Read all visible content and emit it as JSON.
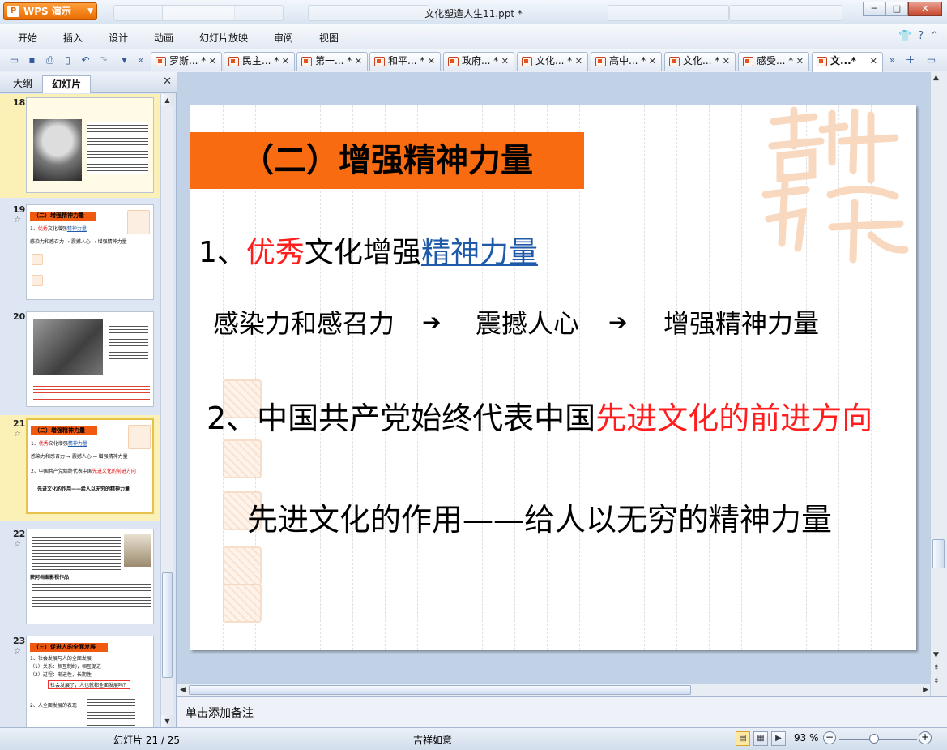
{
  "app": {
    "menu_button": "WPS 演示",
    "window_title": "文化塑造人生11.ppt *"
  },
  "menu": [
    "开始",
    "插入",
    "设计",
    "动画",
    "幻灯片放映",
    "审阅",
    "视图"
  ],
  "doc_tabs": [
    "罗斯... *",
    "民主... *",
    "第一... *",
    "和平... *",
    "政府... *",
    "文化... *",
    "高中... *",
    "文化... *",
    "感受... *",
    "文...*"
  ],
  "left_panel": {
    "tabs": [
      "大纲",
      "幻灯片"
    ],
    "active_tab": "幻灯片",
    "slides": [
      {
        "num": "18"
      },
      {
        "num": "19",
        "star": "☆"
      },
      {
        "num": "20"
      },
      {
        "num": "21",
        "star": "☆"
      },
      {
        "num": "22",
        "star": "☆"
      },
      {
        "num": "23",
        "star": "☆"
      }
    ],
    "thumb19": {
      "title": "（二）增强精神力量",
      "l1_a": "1、",
      "l1_red": "优秀",
      "l1_b": "文化增强",
      "l1_link": "精神力量",
      "l2": "感染力和感召力 → 震撼人心 → 增强精神力量"
    },
    "thumb21": {
      "title": "（二）增强精神力量",
      "l1_a": "1、",
      "l1_red": "优秀",
      "l1_b": "文化增强",
      "l1_link": "精神力量",
      "l2": "感染力和感召力 → 震撼人心 → 增强精神力量",
      "l3_a": "2、中国共产党始终代表中国",
      "l3_red": "先进文化的前进方向",
      "l4": "先进文化的作用——给人以无穷的精神力量"
    },
    "thumb22": {
      "title": "获阿档案影视作品："
    },
    "thumb23": {
      "title": "（三）促进人的全面发展",
      "l1": "1、社会发展与人的全面发展",
      "l2": "（1）关系：相互制约，相互促进",
      "l3": "（2）过程：渐进性，长期性",
      "box": "社会发展了，人也就都全面发展吗？",
      "l4": "2、人全面发展的表现"
    }
  },
  "slide": {
    "title": "（二）增强精神力量",
    "line1": {
      "prefix": "1、",
      "red": "优秀",
      "middle": "文化增强",
      "link": "精神力量"
    },
    "flow": [
      "感染力和感召力",
      "震撼人心",
      "增强精神力量"
    ],
    "arrow_glyph": "➔",
    "line2": {
      "prefix": "2、中国共产党始终代表中国",
      "red": "先进文化的前进方向"
    },
    "line3": "先进文化的作用——给人以无穷的精神力量"
  },
  "notes_placeholder": "单击添加备注",
  "status": {
    "slide_counter": "幻灯片 21 / 25",
    "theme": "吉祥如意",
    "zoom": "93 %",
    "zoom_level_fraction": 0.45
  },
  "colors": {
    "accent_orange": "#f86b10",
    "text_red": "#ff1d1d",
    "link_blue": "#1f5aa8"
  }
}
